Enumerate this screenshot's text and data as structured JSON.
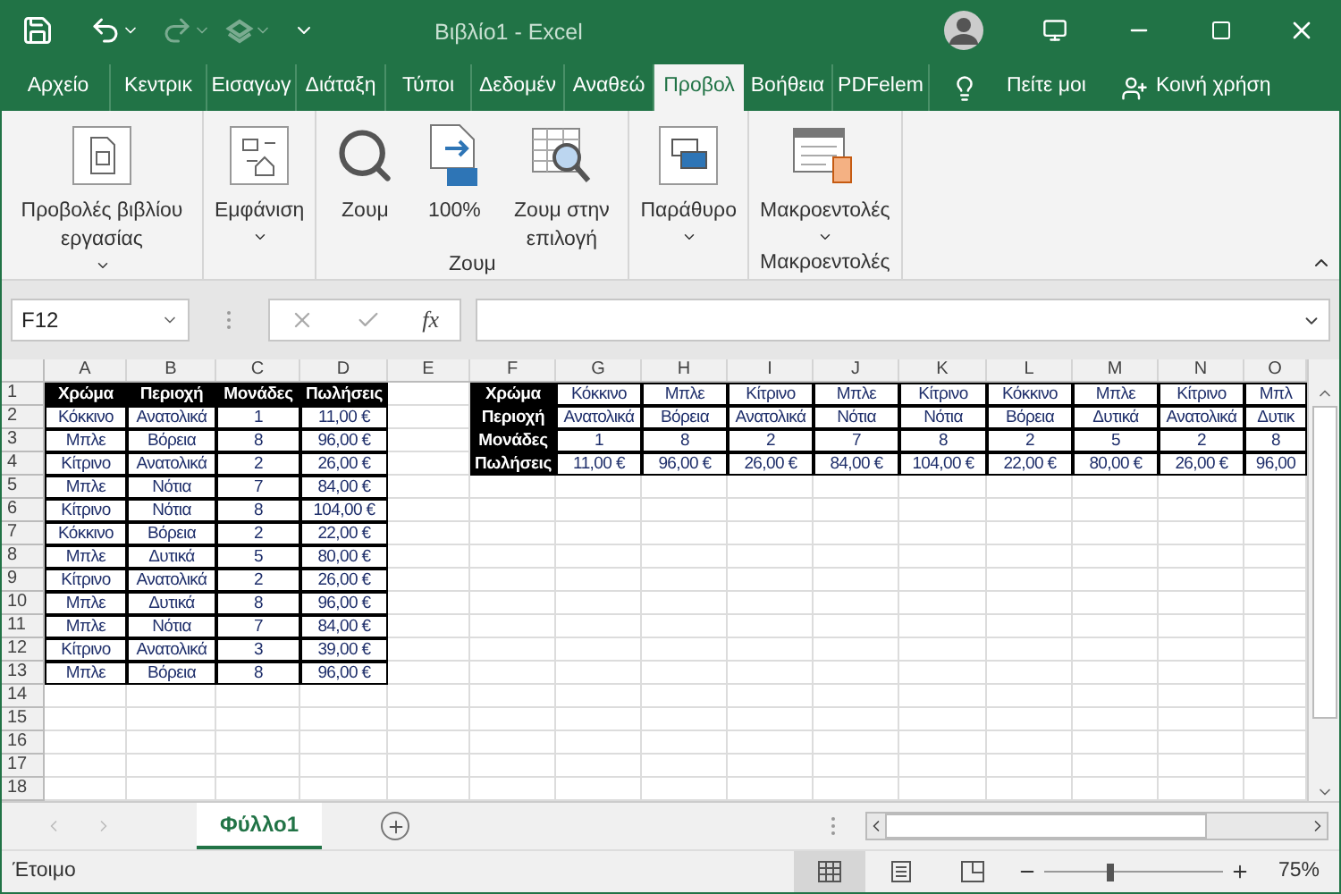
{
  "title_bar": {
    "title": "Βιβλίο1 - Excel"
  },
  "tabs": [
    {
      "label": "Αρχείο",
      "selected": false
    },
    {
      "label": "Κεντρικ",
      "selected": false
    },
    {
      "label": "Εισαγωγ",
      "selected": false
    },
    {
      "label": "Διάταξη",
      "selected": false
    },
    {
      "label": "Τύποι",
      "selected": false
    },
    {
      "label": "Δεδομέν",
      "selected": false
    },
    {
      "label": "Αναθεώ",
      "selected": false
    },
    {
      "label": "Προβολ",
      "selected": true
    },
    {
      "label": "Βοήθεια",
      "selected": false
    },
    {
      "label": "PDFelem",
      "selected": false
    }
  ],
  "tell_me": {
    "label": "Πείτε μοι"
  },
  "share": {
    "label": "Κοινή χρήση"
  },
  "ribbon_groups": [
    {
      "buttons": [
        {
          "label": "Προβολές βιβλίου εργασίας",
          "dropdown": true
        }
      ]
    },
    {
      "buttons": [
        {
          "label": "Εμφάνιση",
          "dropdown": true
        }
      ]
    },
    {
      "label": "Ζουμ",
      "buttons": [
        {
          "label": "Ζουμ",
          "dropdown": false
        },
        {
          "label": "100%",
          "dropdown": false
        },
        {
          "label": "Ζουμ στην επιλογή",
          "dropdown": false
        }
      ]
    },
    {
      "buttons": [
        {
          "label": "Παράθυρο",
          "dropdown": true
        }
      ]
    },
    {
      "label": "Μακροεντολές",
      "buttons": [
        {
          "label": "Μακροεντολές",
          "dropdown": true
        }
      ]
    }
  ],
  "formula_bar": {
    "name_box": "F12",
    "function_label": "fx"
  },
  "sheet": {
    "columns": [
      "A",
      "B",
      "C",
      "D",
      "E",
      "F",
      "G",
      "H",
      "I",
      "J",
      "K",
      "L",
      "M",
      "N",
      "O"
    ],
    "rows": [
      "1",
      "2",
      "3",
      "4",
      "5",
      "6",
      "7",
      "8",
      "9",
      "10",
      "11",
      "12",
      "13",
      "14",
      "15",
      "16",
      "17",
      "18"
    ],
    "table_1": {
      "header": [
        "Χρώμα",
        "Περιοχή",
        "Μονάδες",
        "Πωλήσεις"
      ],
      "rows": [
        [
          "Κόκκινο",
          "Ανατολικά",
          "1",
          "11,00 €"
        ],
        [
          "Μπλε",
          "Βόρεια",
          "8",
          "96,00 €"
        ],
        [
          "Κίτρινο",
          "Ανατολικά",
          "2",
          "26,00 €"
        ],
        [
          "Μπλε",
          "Νότια",
          "7",
          "84,00 €"
        ],
        [
          "Κίτρινο",
          "Νότια",
          "8",
          "104,00 €"
        ],
        [
          "Κόκκινο",
          "Βόρεια",
          "2",
          "22,00 €"
        ],
        [
          "Μπλε",
          "Δυτικά",
          "5",
          "80,00 €"
        ],
        [
          "Κίτρινο",
          "Ανατολικά",
          "2",
          "26,00 €"
        ],
        [
          "Μπλε",
          "Δυτικά",
          "8",
          "96,00 €"
        ],
        [
          "Μπλε",
          "Νότια",
          "7",
          "84,00 €"
        ],
        [
          "Κίτρινο",
          "Ανατολικά",
          "3",
          "39,00 €"
        ],
        [
          "Μπλε",
          "Βόρεια",
          "8",
          "96,00 €"
        ]
      ]
    },
    "table_2": {
      "rows": [
        {
          "label": "Χρώμα",
          "values": [
            "Κόκκινο",
            "Μπλε",
            "Κίτρινο",
            "Μπλε",
            "Κίτρινο",
            "Κόκκινο",
            "Μπλε",
            "Κίτρινο",
            "Μπλ"
          ]
        },
        {
          "label": "Περιοχή",
          "values": [
            "Ανατολικά",
            "Βόρεια",
            "Ανατολικά",
            "Νότια",
            "Νότια",
            "Βόρεια",
            "Δυτικά",
            "Ανατολικά",
            "Δυτικ"
          ]
        },
        {
          "label": "Μονάδες",
          "values": [
            "1",
            "8",
            "2",
            "7",
            "8",
            "2",
            "5",
            "2",
            "8"
          ]
        },
        {
          "label": "Πωλήσεις",
          "values": [
            "11,00 €",
            "96,00 €",
            "26,00 €",
            "84,00 €",
            "104,00 €",
            "22,00 €",
            "80,00 €",
            "26,00 €",
            "96,00"
          ]
        }
      ]
    }
  },
  "sheet_tabs": [
    {
      "label": "Φύλλο1",
      "selected": true
    }
  ],
  "status_bar": {
    "status": "Έτοιμο",
    "views": [
      {
        "selected": true
      },
      {
        "selected": false
      },
      {
        "selected": false
      }
    ],
    "zoom": {
      "level": 0.37,
      "reading": "75%"
    }
  }
}
